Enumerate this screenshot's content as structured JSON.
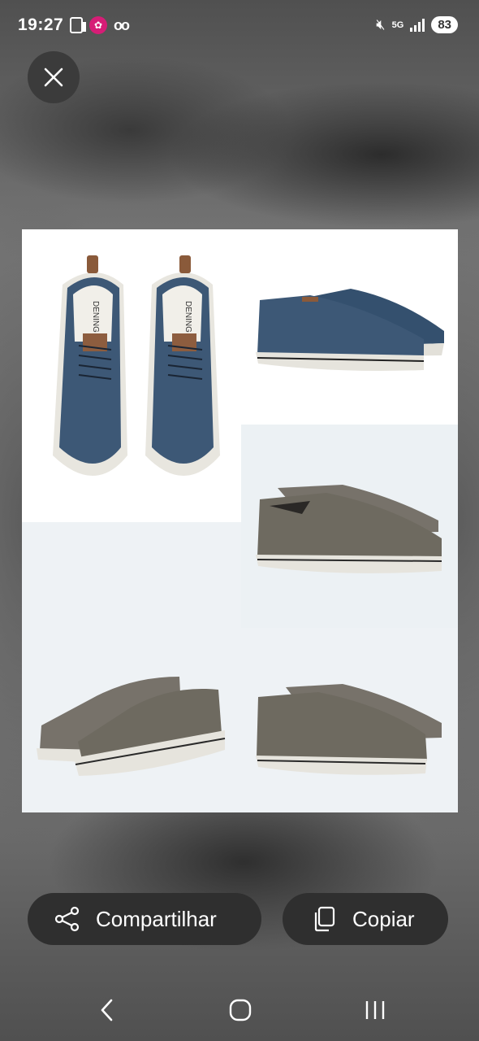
{
  "status_bar": {
    "time": "19:27",
    "network": "5G",
    "battery": "83",
    "icons": [
      "sim-icon",
      "app-notification-icon",
      "voicemail-icon",
      "mute-icon",
      "5g-icon",
      "signal-icon",
      "battery-icon"
    ]
  },
  "viewer": {
    "close_icon": "close-icon",
    "image_label": "DENING"
  },
  "actions": {
    "share_label": "Compartilhar",
    "share_icon": "share-icon",
    "copy_label": "Copiar",
    "copy_icon": "copy-icon"
  },
  "navigation": {
    "back_icon": "back-icon",
    "home_icon": "home-icon",
    "recents_icon": "recents-icon"
  },
  "colors": {
    "shoe_blue": "#3d5876",
    "shoe_gray": "#6e6a60",
    "sole": "#e6e4dd",
    "button_bg": "#2f2f2f"
  }
}
